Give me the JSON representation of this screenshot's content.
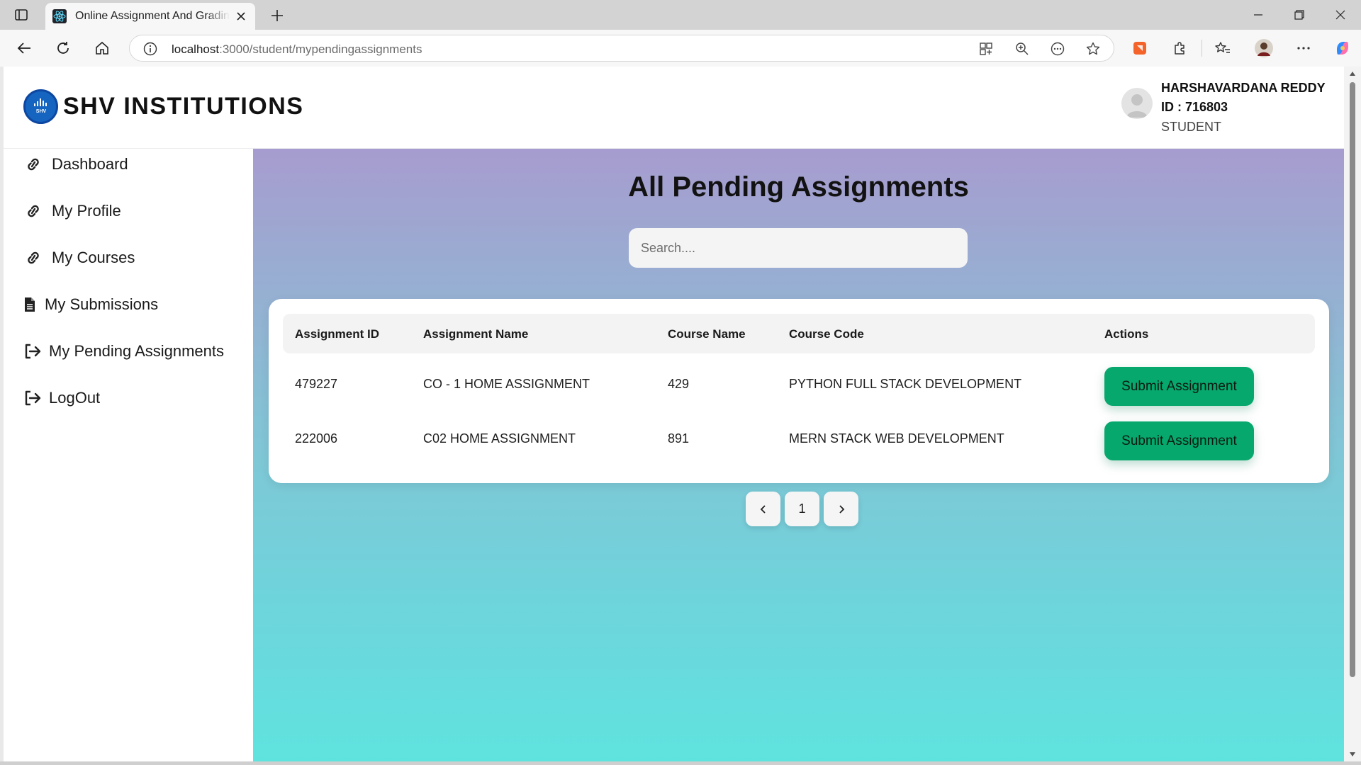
{
  "browser": {
    "tab_title": "Online Assignment And Grading System",
    "address_host": "localhost",
    "address_rest": ":3000/student/mypendingassignments"
  },
  "icons": {
    "nav_link": "link-icon",
    "nav_file": "file-icon",
    "nav_exit": "sign-out-icon"
  },
  "header": {
    "brand_name": "SHV INSTITUTIONS",
    "logo_text": "SHV",
    "user": {
      "name": "HARSHAVARDANA REDDY",
      "id_label": "ID : 716803",
      "role": "STUDENT"
    }
  },
  "sidebar": {
    "items": [
      {
        "label": "Dashboard",
        "icon": "link-icon"
      },
      {
        "label": "My Profile",
        "icon": "link-icon"
      },
      {
        "label": "My Courses",
        "icon": "link-icon"
      },
      {
        "label": "My Submissions",
        "icon": "file-icon"
      },
      {
        "label": "My Pending Assignments",
        "icon": "sign-out-icon"
      },
      {
        "label": "LogOut",
        "icon": "sign-out-icon"
      }
    ]
  },
  "main": {
    "title": "All Pending Assignments",
    "search_placeholder": "Search....",
    "columns": [
      "Assignment ID",
      "Assignment Name",
      "Course Name",
      "Course Code",
      "Actions"
    ],
    "rows": [
      {
        "assignment_id": "479227",
        "assignment_name": "CO - 1 HOME ASSIGNMENT",
        "course_name": "429",
        "course_code": "PYTHON FULL STACK DEVELOPMENT",
        "action": "Submit Assignment"
      },
      {
        "assignment_id": "222006",
        "assignment_name": "C02 HOME ASSIGNMENT",
        "course_name": "891",
        "course_code": "MERN STACK WEB DEVELOPMENT",
        "action": "Submit Assignment"
      }
    ],
    "pagination": {
      "current_page": "1"
    }
  },
  "colors": {
    "accent_button": "#06a86d",
    "gradient_top": "#a79ccf",
    "gradient_bottom": "#5fe3df",
    "brand_logo": "#1565c0"
  }
}
